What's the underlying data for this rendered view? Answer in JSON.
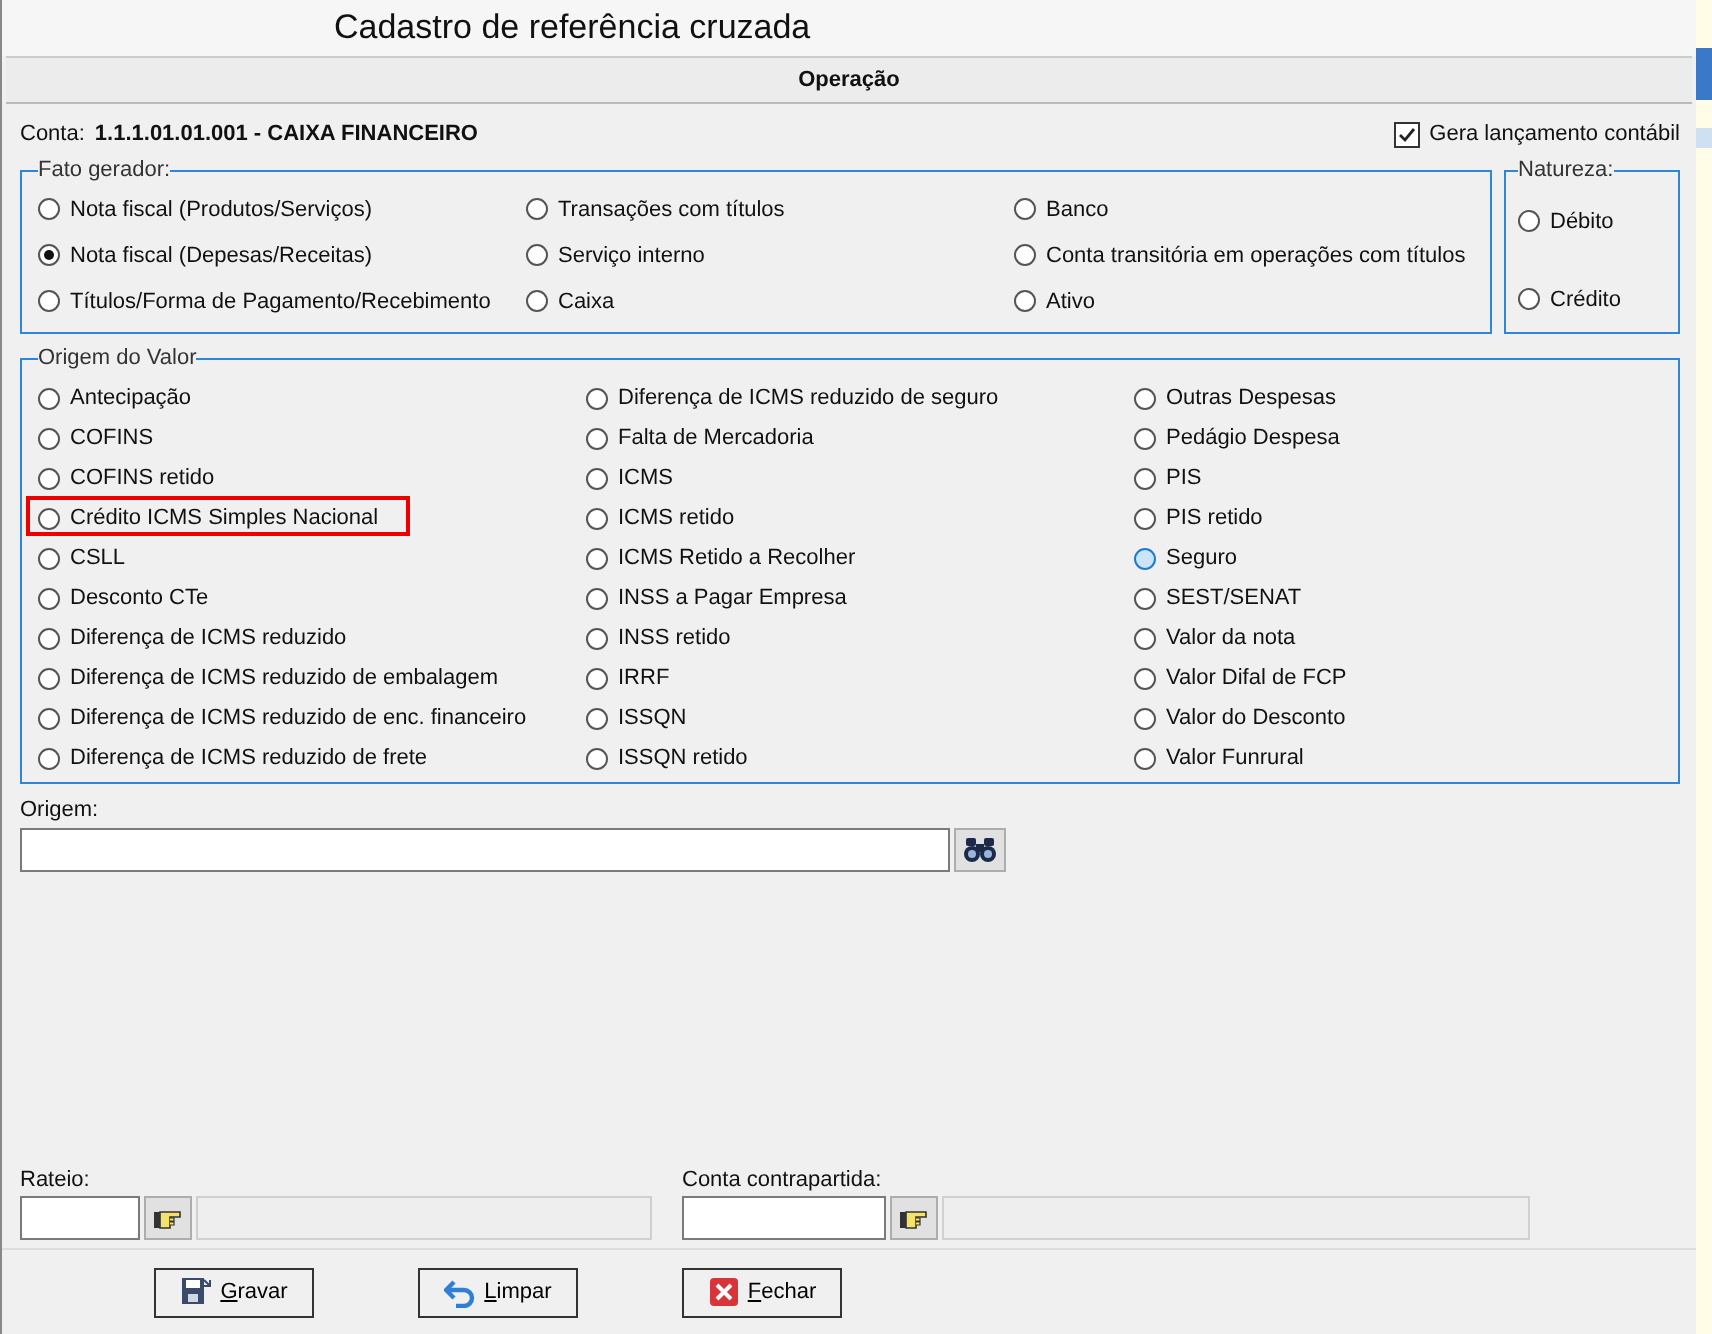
{
  "window": {
    "title": "Cadastro de referência cruzada"
  },
  "section_header": "Operação",
  "conta": {
    "label": "Conta:",
    "value": "1.1.1.01.01.001 - CAIXA FINANCEIRO"
  },
  "gera_lancamento": {
    "label": "Gera lançamento contábil",
    "checked": true
  },
  "fato_gerador": {
    "title": "Fato gerador:",
    "columns": [
      [
        {
          "label": "Nota fiscal (Produtos/Serviços)",
          "selected": false
        },
        {
          "label": "Nota fiscal (Depesas/Receitas)",
          "selected": true
        },
        {
          "label": "Títulos/Forma de Pagamento/Recebimento",
          "selected": false
        }
      ],
      [
        {
          "label": "Transações com títulos",
          "selected": false
        },
        {
          "label": "Serviço interno",
          "selected": false
        },
        {
          "label": "Caixa",
          "selected": false
        }
      ],
      [
        {
          "label": "Banco",
          "selected": false
        },
        {
          "label": "Conta transitória em operações com títulos",
          "selected": false
        },
        {
          "label": "Ativo",
          "selected": false
        }
      ]
    ]
  },
  "natureza": {
    "title": "Natureza:",
    "options": [
      {
        "label": "Débito",
        "selected": false
      },
      {
        "label": "Crédito",
        "selected": false
      }
    ]
  },
  "origem_do_valor": {
    "title": "Origem do Valor",
    "columns": [
      [
        {
          "label": "Antecipação",
          "selected": false,
          "hovered": false,
          "marked": false
        },
        {
          "label": "COFINS",
          "selected": false,
          "hovered": false,
          "marked": false
        },
        {
          "label": "COFINS retido",
          "selected": false,
          "hovered": false,
          "marked": false
        },
        {
          "label": "Crédito ICMS Simples Nacional",
          "selected": false,
          "hovered": false,
          "marked": true
        },
        {
          "label": "CSLL",
          "selected": false,
          "hovered": false,
          "marked": false
        },
        {
          "label": "Desconto CTe",
          "selected": false,
          "hovered": false,
          "marked": false
        },
        {
          "label": "Diferença de ICMS reduzido",
          "selected": false,
          "hovered": false,
          "marked": false
        },
        {
          "label": "Diferença de ICMS reduzido de embalagem",
          "selected": false,
          "hovered": false,
          "marked": false
        },
        {
          "label": "Diferença de ICMS reduzido de enc. financeiro",
          "selected": false,
          "hovered": false,
          "marked": false
        },
        {
          "label": "Diferença de ICMS reduzido de frete",
          "selected": false,
          "hovered": false,
          "marked": false
        }
      ],
      [
        {
          "label": "Diferença de ICMS reduzido de seguro",
          "selected": false,
          "hovered": false,
          "marked": false
        },
        {
          "label": "Falta de Mercadoria",
          "selected": false,
          "hovered": false,
          "marked": false
        },
        {
          "label": "ICMS",
          "selected": false,
          "hovered": false,
          "marked": false
        },
        {
          "label": "ICMS retido",
          "selected": false,
          "hovered": false,
          "marked": false
        },
        {
          "label": "ICMS Retido a Recolher",
          "selected": false,
          "hovered": false,
          "marked": false
        },
        {
          "label": "INSS a Pagar Empresa",
          "selected": false,
          "hovered": false,
          "marked": false
        },
        {
          "label": "INSS retido",
          "selected": false,
          "hovered": false,
          "marked": false
        },
        {
          "label": "IRRF",
          "selected": false,
          "hovered": false,
          "marked": false
        },
        {
          "label": "ISSQN",
          "selected": false,
          "hovered": false,
          "marked": false
        },
        {
          "label": "ISSQN retido",
          "selected": false,
          "hovered": false,
          "marked": false
        }
      ],
      [
        {
          "label": "Outras Despesas",
          "selected": false,
          "hovered": false,
          "marked": false
        },
        {
          "label": "Pedágio Despesa",
          "selected": false,
          "hovered": false,
          "marked": false
        },
        {
          "label": "PIS",
          "selected": false,
          "hovered": false,
          "marked": false
        },
        {
          "label": "PIS retido",
          "selected": false,
          "hovered": false,
          "marked": false
        },
        {
          "label": "Seguro",
          "selected": false,
          "hovered": true,
          "marked": false
        },
        {
          "label": "SEST/SENAT",
          "selected": false,
          "hovered": false,
          "marked": false
        },
        {
          "label": "Valor da nota",
          "selected": false,
          "hovered": false,
          "marked": false
        },
        {
          "label": "Valor Difal de FCP",
          "selected": false,
          "hovered": false,
          "marked": false
        },
        {
          "label": "Valor do Desconto",
          "selected": false,
          "hovered": false,
          "marked": false
        },
        {
          "label": "Valor Funrural",
          "selected": false,
          "hovered": false,
          "marked": false
        }
      ]
    ]
  },
  "origem": {
    "label": "Origem:"
  },
  "rateio": {
    "label": "Rateio:"
  },
  "conta_contrapartida": {
    "label": "Conta contrapartida:"
  },
  "buttons": [
    {
      "label": "Gravar",
      "kind": "save"
    },
    {
      "label": "Limpar",
      "kind": "undo"
    },
    {
      "label": "Fechar",
      "kind": "close"
    }
  ]
}
